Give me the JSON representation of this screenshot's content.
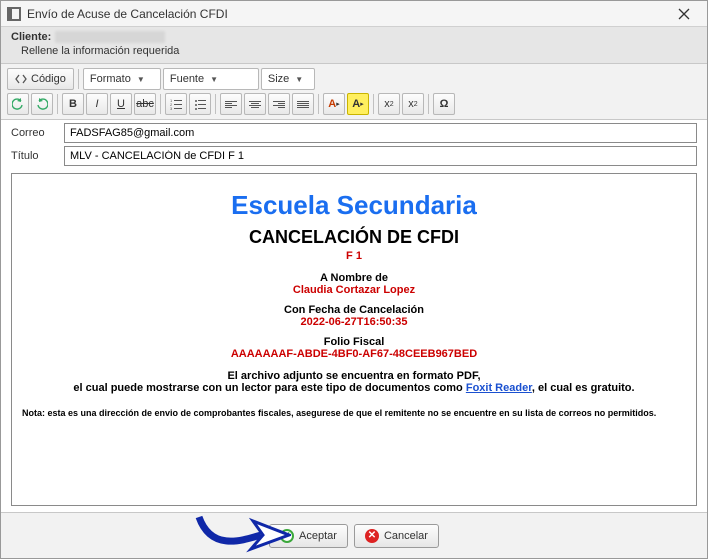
{
  "window": {
    "title": "Envío de Acuse de Cancelación CFDI"
  },
  "client": {
    "label": "Cliente:",
    "hint": "Rellene la información requerida"
  },
  "toolbar": {
    "source_label": "Código",
    "format_label": "Formato",
    "font_label": "Fuente",
    "size_label": "Size"
  },
  "fields": {
    "correo_label": "Correo",
    "correo_value": "FADSFAG85@gmail.com",
    "titulo_label": "Título",
    "titulo_value": "MLV - CANCELACIÓN de CFDI F 1"
  },
  "body": {
    "org": "Escuela Secundaria",
    "heading": "CANCELACIÓN DE CFDI",
    "folio_short": "F 1",
    "name_label": "A Nombre de",
    "name_value": "Claudia Cortazar Lopez",
    "date_label": "Con Fecha de Cancelación",
    "date_value": "2022-06-27T16:50:35",
    "fiscal_label": "Folio Fiscal",
    "fiscal_value": "AAAAAAAF-ABDE-4BF0-AF67-48CEEB967BED",
    "pdf_line1": "El archivo adjunto se encuentra en formato PDF,",
    "pdf_line2a": "el cual puede mostrarse con un lector para este tipo de documentos como ",
    "foxit": "Foxit Reader",
    "pdf_line2b": ", el cual es gratuito.",
    "note": "Nota: esta es una dirección de envio de comprobantes fiscales, asegurese de que el remitente no se encuentre en su lista de correos no permitidos."
  },
  "footer": {
    "accept": "Aceptar",
    "cancel": "Cancelar"
  }
}
